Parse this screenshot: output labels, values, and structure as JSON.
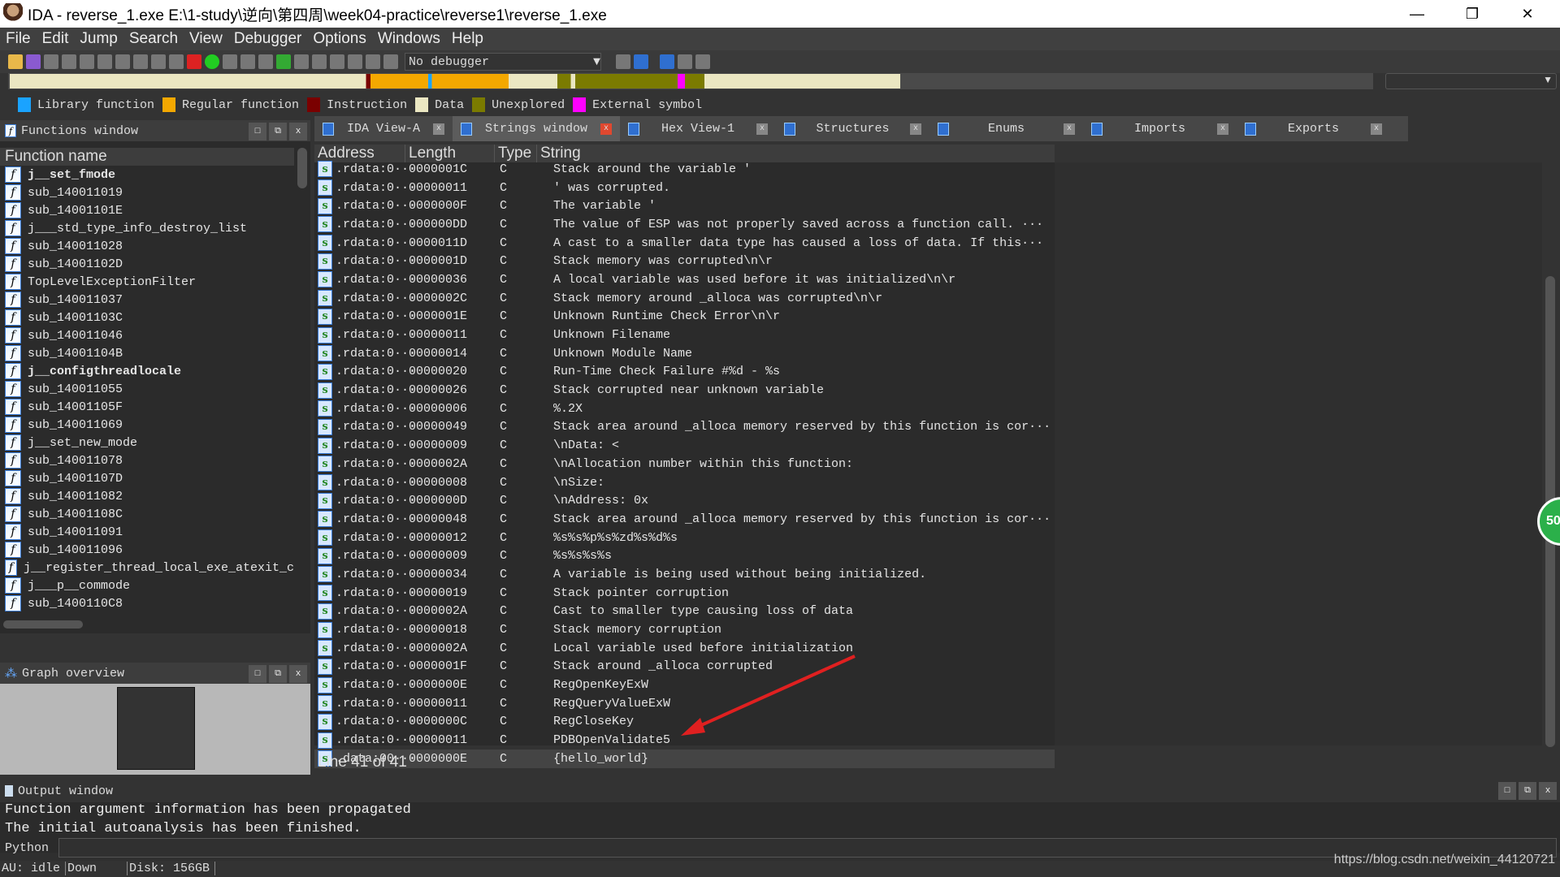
{
  "window": {
    "title": "IDA - reverse_1.exe E:\\1-study\\逆向\\第四周\\week04-practice\\reverse1\\reverse_1.exe"
  },
  "menu": [
    "File",
    "Edit",
    "Jump",
    "Search",
    "View",
    "Debugger",
    "Options",
    "Windows",
    "Help"
  ],
  "toolbar": {
    "debugger_select": "No debugger"
  },
  "legend": [
    {
      "label": "Library function",
      "color": "#1aa3ff"
    },
    {
      "label": "Regular function",
      "color": "#f4a800"
    },
    {
      "label": "Instruction",
      "color": "#7a0000"
    },
    {
      "label": "Data",
      "color": "#ebe7c2"
    },
    {
      "label": "Unexplored",
      "color": "#7b7b00"
    },
    {
      "label": "External symbol",
      "color": "#ff00ff"
    }
  ],
  "functions": {
    "title": "Functions window",
    "column": "Function name",
    "items": [
      {
        "name": "j__set_fmode",
        "bold": true
      },
      {
        "name": "sub_140011019"
      },
      {
        "name": "sub_14001101E"
      },
      {
        "name": "j___std_type_info_destroy_list"
      },
      {
        "name": "sub_140011028"
      },
      {
        "name": "sub_14001102D"
      },
      {
        "name": "TopLevelExceptionFilter"
      },
      {
        "name": "sub_140011037"
      },
      {
        "name": "sub_14001103C"
      },
      {
        "name": "sub_140011046"
      },
      {
        "name": "sub_14001104B"
      },
      {
        "name": "j__configthreadlocale",
        "bold": true
      },
      {
        "name": "sub_140011055"
      },
      {
        "name": "sub_14001105F"
      },
      {
        "name": "sub_140011069"
      },
      {
        "name": "j__set_new_mode"
      },
      {
        "name": "sub_140011078"
      },
      {
        "name": "sub_14001107D"
      },
      {
        "name": "sub_140011082"
      },
      {
        "name": "sub_14001108C"
      },
      {
        "name": "sub_140011091"
      },
      {
        "name": "sub_140011096"
      },
      {
        "name": "j__register_thread_local_exe_atexit_c"
      },
      {
        "name": "j___p__commode"
      },
      {
        "name": "sub_1400110C8"
      }
    ]
  },
  "graph_overview": {
    "title": "Graph overview"
  },
  "tabs": [
    {
      "label": "IDA View-A",
      "active": false
    },
    {
      "label": "Strings window",
      "active": true
    },
    {
      "label": "Hex View-1",
      "active": false
    },
    {
      "label": "Structures",
      "active": false
    },
    {
      "label": "Enums",
      "active": false
    },
    {
      "label": "Imports",
      "active": false
    },
    {
      "label": "Exports",
      "active": false
    }
  ],
  "strings": {
    "columns": [
      "Address",
      "Length",
      "Type",
      "String"
    ],
    "rows": [
      [
        ".rdata:0···",
        "0000001C",
        "C",
        "Stack around the variable '"
      ],
      [
        ".rdata:0···",
        "00000011",
        "C",
        "' was corrupted."
      ],
      [
        ".rdata:0···",
        "0000000F",
        "C",
        "The variable '"
      ],
      [
        ".rdata:0···",
        "000000DD",
        "C",
        "The value of ESP was not properly saved across a function call.  ···"
      ],
      [
        ".rdata:0···",
        "0000011D",
        "C",
        "A cast to a smaller data type has caused a loss of data.  If this···"
      ],
      [
        ".rdata:0···",
        "0000001D",
        "C",
        "Stack memory was corrupted\\n\\r"
      ],
      [
        ".rdata:0···",
        "00000036",
        "C",
        "A local variable was used before it was initialized\\n\\r"
      ],
      [
        ".rdata:0···",
        "0000002C",
        "C",
        "Stack memory around _alloca was corrupted\\n\\r"
      ],
      [
        ".rdata:0···",
        "0000001E",
        "C",
        "Unknown Runtime Check Error\\n\\r"
      ],
      [
        ".rdata:0···",
        "00000011",
        "C",
        "Unknown Filename"
      ],
      [
        ".rdata:0···",
        "00000014",
        "C",
        "Unknown Module Name"
      ],
      [
        ".rdata:0···",
        "00000020",
        "C",
        "Run-Time Check Failure #%d - %s"
      ],
      [
        ".rdata:0···",
        "00000026",
        "C",
        "Stack corrupted near unknown variable"
      ],
      [
        ".rdata:0···",
        "00000006",
        "C",
        "%.2X"
      ],
      [
        ".rdata:0···",
        "00000049",
        "C",
        "Stack area around _alloca memory reserved by this function is cor···"
      ],
      [
        ".rdata:0···",
        "00000009",
        "C",
        "\\nData: <"
      ],
      [
        ".rdata:0···",
        "0000002A",
        "C",
        "\\nAllocation number within this function:"
      ],
      [
        ".rdata:0···",
        "00000008",
        "C",
        "\\nSize:"
      ],
      [
        ".rdata:0···",
        "0000000D",
        "C",
        "\\nAddress: 0x"
      ],
      [
        ".rdata:0···",
        "00000048",
        "C",
        "Stack area around _alloca memory reserved by this function is cor···"
      ],
      [
        ".rdata:0···",
        "00000012",
        "C",
        "%s%s%p%s%zd%s%d%s"
      ],
      [
        ".rdata:0···",
        "00000009",
        "C",
        "%s%s%s%s"
      ],
      [
        ".rdata:0···",
        "00000034",
        "C",
        "A variable is being used without being initialized."
      ],
      [
        ".rdata:0···",
        "00000019",
        "C",
        "Stack pointer corruption"
      ],
      [
        ".rdata:0···",
        "0000002A",
        "C",
        "Cast to smaller type causing loss of data"
      ],
      [
        ".rdata:0···",
        "00000018",
        "C",
        "Stack memory corruption"
      ],
      [
        ".rdata:0···",
        "0000002A",
        "C",
        "Local variable used before initialization"
      ],
      [
        ".rdata:0···",
        "0000001F",
        "C",
        "Stack around _alloca corrupted"
      ],
      [
        ".rdata:0···",
        "0000000E",
        "C",
        "RegOpenKeyExW"
      ],
      [
        ".rdata:0···",
        "00000011",
        "C",
        "RegQueryValueExW"
      ],
      [
        ".rdata:0···",
        "0000000C",
        "C",
        "RegCloseKey"
      ],
      [
        ".rdata:0···",
        "00000011",
        "C",
        "PDBOpenValidate5"
      ],
      [
        ".data:00···",
        "0000000E",
        "C",
        "{hello_world}"
      ]
    ],
    "selected_index": 32,
    "line_info": "Line 41 of 41"
  },
  "badge": "50",
  "output": {
    "title": "Output window",
    "lines": [
      "Function argument information has been propagated",
      "The initial autoanalysis has been finished."
    ]
  },
  "python": {
    "label": "Python"
  },
  "status": {
    "au": "AU:  idle",
    "direction": "Down",
    "disk": "Disk: 156GB"
  },
  "watermark": "https://blog.csdn.net/weixin_44120721"
}
